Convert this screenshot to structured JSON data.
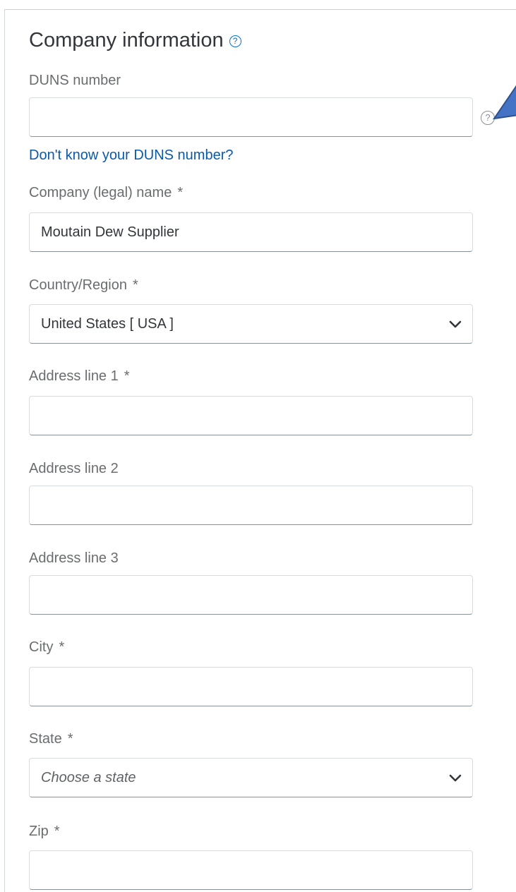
{
  "section": {
    "title": "Company information",
    "help_icon": "question-circle-icon"
  },
  "duns": {
    "label": "DUNS number",
    "value": "",
    "help_icon": "question-circle-icon",
    "link": "Don't know your DUNS number?"
  },
  "company_name": {
    "label": "Company (legal) name",
    "required": "*",
    "value": "Moutain Dew Supplier"
  },
  "country": {
    "label": "Country/Region",
    "required": "*",
    "selected": "United States [ USA ]",
    "icon": "chevron-down-icon"
  },
  "address1": {
    "label": "Address line 1",
    "required": "*",
    "value": ""
  },
  "address2": {
    "label": "Address line 2",
    "value": ""
  },
  "address3": {
    "label": "Address line 3",
    "value": ""
  },
  "city": {
    "label": "City",
    "required": "*",
    "value": ""
  },
  "state": {
    "label": "State",
    "required": "*",
    "placeholder": "Choose a state",
    "icon": "chevron-down-icon"
  },
  "zip": {
    "label": "Zip",
    "required": "*",
    "value": ""
  },
  "colors": {
    "link": "#0a5aab",
    "accent": "#0a6ed1",
    "callout": "#4472c4"
  }
}
